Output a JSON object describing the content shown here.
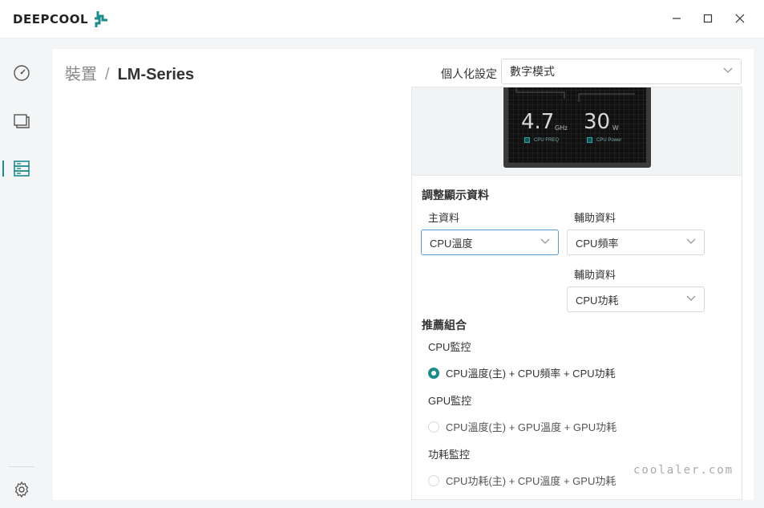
{
  "app": {
    "logo_text": "DEEPCOOL",
    "window_controls": {
      "minimize": "—",
      "maximize": "☐",
      "close": "✕"
    }
  },
  "sidebar": {
    "items": [
      {
        "icon": "speedometer-icon",
        "active": false
      },
      {
        "icon": "monitor-icon",
        "active": false
      },
      {
        "icon": "device-list-icon",
        "active": true
      }
    ],
    "settings_icon": "gear-icon"
  },
  "breadcrumb": {
    "parent": "裝置",
    "separator": "/",
    "current": "LM-Series"
  },
  "personalize": {
    "label": "個人化設定",
    "value": "數字模式"
  },
  "preview": {
    "freq_value": "4.7",
    "freq_unit": "GHz",
    "freq_tag": "CPU FREQ",
    "power_value": "30",
    "power_unit": "W",
    "power_tag": "CPU Power"
  },
  "display_data": {
    "title": "調整顯示資料",
    "main_label": "主資料",
    "main_value": "CPU溫度",
    "aux1_label": "輔助資料",
    "aux1_value": "CPU頻率",
    "aux2_label": "輔助資料",
    "aux2_value": "CPU功耗"
  },
  "recommended": {
    "title": "推薦組合",
    "groups": [
      {
        "label": "CPU監控",
        "option": "CPU溫度(主) + CPU頻率 + CPU功耗",
        "checked": true
      },
      {
        "label": "GPU監控",
        "option": "CPU溫度(主) + GPU溫度 + GPU功耗",
        "checked": false
      },
      {
        "label": "功耗監控",
        "option": "CPU功耗(主) + CPU溫度 + GPU功耗",
        "checked": false
      }
    ]
  },
  "watermark": "coolaler.com",
  "colors": {
    "accent": "#1e8c8c",
    "focus_border": "#5b9bd5"
  }
}
